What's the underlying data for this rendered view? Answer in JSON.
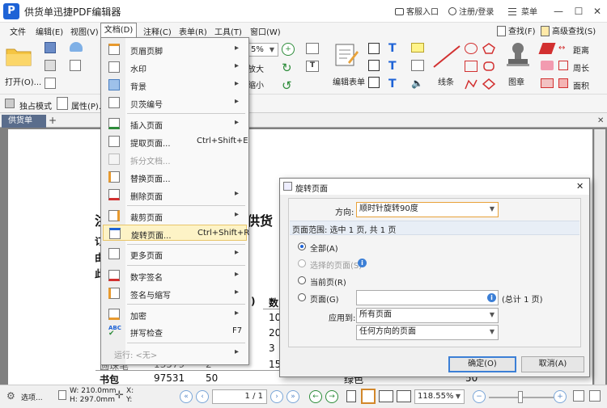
{
  "titlebar": {
    "logo": "P",
    "title": "供货单迅捷PDF编辑器",
    "customer_entry": "客服入口",
    "login": "注册/登录",
    "menu": "菜单",
    "minimize": "—",
    "maximize": "☐",
    "close": "✕"
  },
  "menubar": {
    "items": [
      "文件",
      "编辑(E)",
      "视图(V)",
      "文档(D)",
      "注释(C)",
      "表单(R)",
      "工具(T)",
      "窗口(W)"
    ],
    "find": "查找(F)",
    "advanced_find": "高级查找(S)"
  },
  "ribbon": {
    "open": "打开(O)...",
    "zoom_value": "5%",
    "zoom_in": "放大",
    "zoom_out": "缩小",
    "edit_form": "编辑表单",
    "line": "线条",
    "stamp": "图章",
    "distance": "距离",
    "perimeter": "周长",
    "area": "面积",
    "exclusive_mode": "独占模式",
    "properties": "属性(P)..."
  },
  "tabs": {
    "doc_tab": "供货单",
    "plus": "+"
  },
  "dropdown": {
    "items": [
      {
        "label": "页眉页脚",
        "shortcut": "",
        "arrow": true,
        "disabled": false
      },
      {
        "label": "水印",
        "shortcut": "",
        "arrow": true,
        "disabled": false
      },
      {
        "label": "背景",
        "shortcut": "",
        "arrow": true,
        "disabled": false
      },
      {
        "label": "贝茨编号",
        "shortcut": "",
        "arrow": true,
        "disabled": false
      },
      {
        "label": "插入页面",
        "shortcut": "",
        "arrow": true,
        "disabled": false
      },
      {
        "label": "提取页面...",
        "shortcut": "Ctrl+Shift+E",
        "arrow": false,
        "disabled": false
      },
      {
        "label": "拆分文档...",
        "shortcut": "",
        "arrow": false,
        "disabled": true
      },
      {
        "label": "替换页面...",
        "shortcut": "",
        "arrow": false,
        "disabled": false
      },
      {
        "label": "删除页面",
        "shortcut": "",
        "arrow": true,
        "disabled": false
      },
      {
        "label": "裁剪页面",
        "shortcut": "",
        "arrow": true,
        "disabled": false
      },
      {
        "label": "旋转页面...",
        "shortcut": "Ctrl+Shift+R",
        "arrow": false,
        "disabled": false
      },
      {
        "label": "更多页面",
        "shortcut": "",
        "arrow": true,
        "disabled": false
      },
      {
        "label": "数字签名",
        "shortcut": "",
        "arrow": true,
        "disabled": false
      },
      {
        "label": "签名与缩写",
        "shortcut": "",
        "arrow": true,
        "disabled": false
      },
      {
        "label": "加密",
        "shortcut": "",
        "arrow": true,
        "disabled": false
      },
      {
        "label": "拼写检查",
        "shortcut": "F7",
        "arrow": false,
        "disabled": false
      },
      {
        "label": "运行: <无>",
        "shortcut": "",
        "arrow": true,
        "disabled": true
      }
    ]
  },
  "document": {
    "left_chars": [
      "注",
      "订",
      "由",
      "此"
    ],
    "heading_fragment": "供货",
    "col_paren": ")",
    "col_num_header": "数",
    "num_col": [
      "10",
      "20",
      "3",
      "15"
    ],
    "right_col": [
      "50"
    ],
    "row_partial": {
      "name": "圆珠笔",
      "code": "13579",
      "qty": "2"
    },
    "row_last": {
      "name": "书包",
      "code": "97531",
      "qty": "50",
      "color": "绿色"
    }
  },
  "dialog": {
    "title": "旋转页面",
    "direction_label": "方向:",
    "direction_value": "顺时针旋转90度",
    "range_label": "页面范围: 选中 1 页, 共 1 页",
    "opt_all": "全部(A)",
    "opt_selected": "选择的页面(S)",
    "opt_current": "当前页(R)",
    "opt_pages": "页面(G)",
    "total": "(总计 1 页)",
    "apply_label": "应用到:",
    "apply_value": "所有页面",
    "orientation_value": "任何方向的页面",
    "ok": "确定(O)",
    "cancel": "取消(A)"
  },
  "statusbar": {
    "select": "选项...",
    "width": "W: 210.0mm",
    "height": "H: 297.0mm",
    "x": "X:",
    "y": "Y:",
    "page_indicator": "1 / 1",
    "zoom": "118.55%"
  },
  "colors": {
    "accent": "#1e63d6",
    "doctab": "#5a6d8c",
    "highlight": "#fdf3c6",
    "canvas": "#808080"
  }
}
